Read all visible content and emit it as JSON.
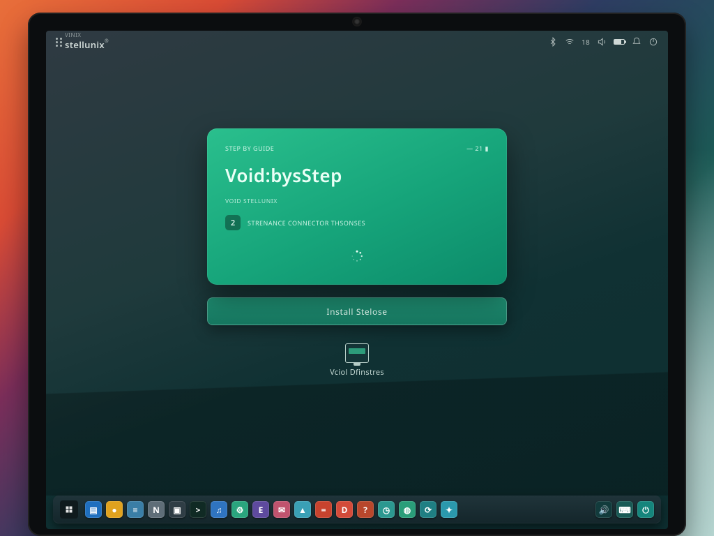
{
  "panel": {
    "brand_small": "VINIX",
    "brand": "stellunix",
    "tray_percent": "18"
  },
  "installer": {
    "kicker": "STEP BY GUIDE",
    "status_right": "21",
    "title": "Void:bysStep",
    "subtitle": "VOID STELLUNIX",
    "step_number": "2",
    "step_text": "STRENANCE CONNECTOR THSONSES",
    "primary_button": "Install Stelose"
  },
  "desktop_icon": {
    "label": "Vciol Dfinstres"
  },
  "taskbar": {
    "apps": [
      {
        "name": "files",
        "glyph": "▤",
        "bg": "#1f6fbf"
      },
      {
        "name": "chat",
        "glyph": "●",
        "bg": "#e0a21e"
      },
      {
        "name": "web",
        "glyph": "≡",
        "bg": "#3a7ea6"
      },
      {
        "name": "notes",
        "glyph": "N",
        "bg": "#5f6e78"
      },
      {
        "name": "store",
        "glyph": "▣",
        "bg": "#2f3d45"
      },
      {
        "name": "terminal",
        "glyph": ">",
        "bg": "#102a24"
      },
      {
        "name": "music",
        "glyph": "♫",
        "bg": "#2f74c0"
      },
      {
        "name": "settings",
        "glyph": "⚙",
        "bg": "#2aa57e"
      },
      {
        "name": "editor",
        "glyph": "E",
        "bg": "#5e4a9e"
      },
      {
        "name": "mail",
        "glyph": "✉",
        "bg": "#c0536e"
      },
      {
        "name": "photos",
        "glyph": "▲",
        "bg": "#3aa0b5"
      },
      {
        "name": "calc",
        "glyph": "=",
        "bg": "#c8432e"
      },
      {
        "name": "docs",
        "glyph": "D",
        "bg": "#d34b3a"
      },
      {
        "name": "help",
        "glyph": "?",
        "bg": "#b8472c"
      },
      {
        "name": "monitor",
        "glyph": "◷",
        "bg": "#2c9890"
      },
      {
        "name": "disk",
        "glyph": "◍",
        "bg": "#2a9e79"
      },
      {
        "name": "update",
        "glyph": "⟳",
        "bg": "#1f7f83"
      },
      {
        "name": "network",
        "glyph": "✦",
        "bg": "#2b99ad"
      }
    ],
    "right": [
      {
        "name": "volume",
        "glyph": "🔊",
        "bg": "#123b3c"
      },
      {
        "name": "keyboard",
        "glyph": "⌨",
        "bg": "#195a55"
      },
      {
        "name": "power",
        "glyph": "⏻",
        "bg": "#15857c"
      }
    ]
  },
  "colors": {
    "accent": "#16a47a",
    "panel_fg": "#cfd8d6"
  }
}
